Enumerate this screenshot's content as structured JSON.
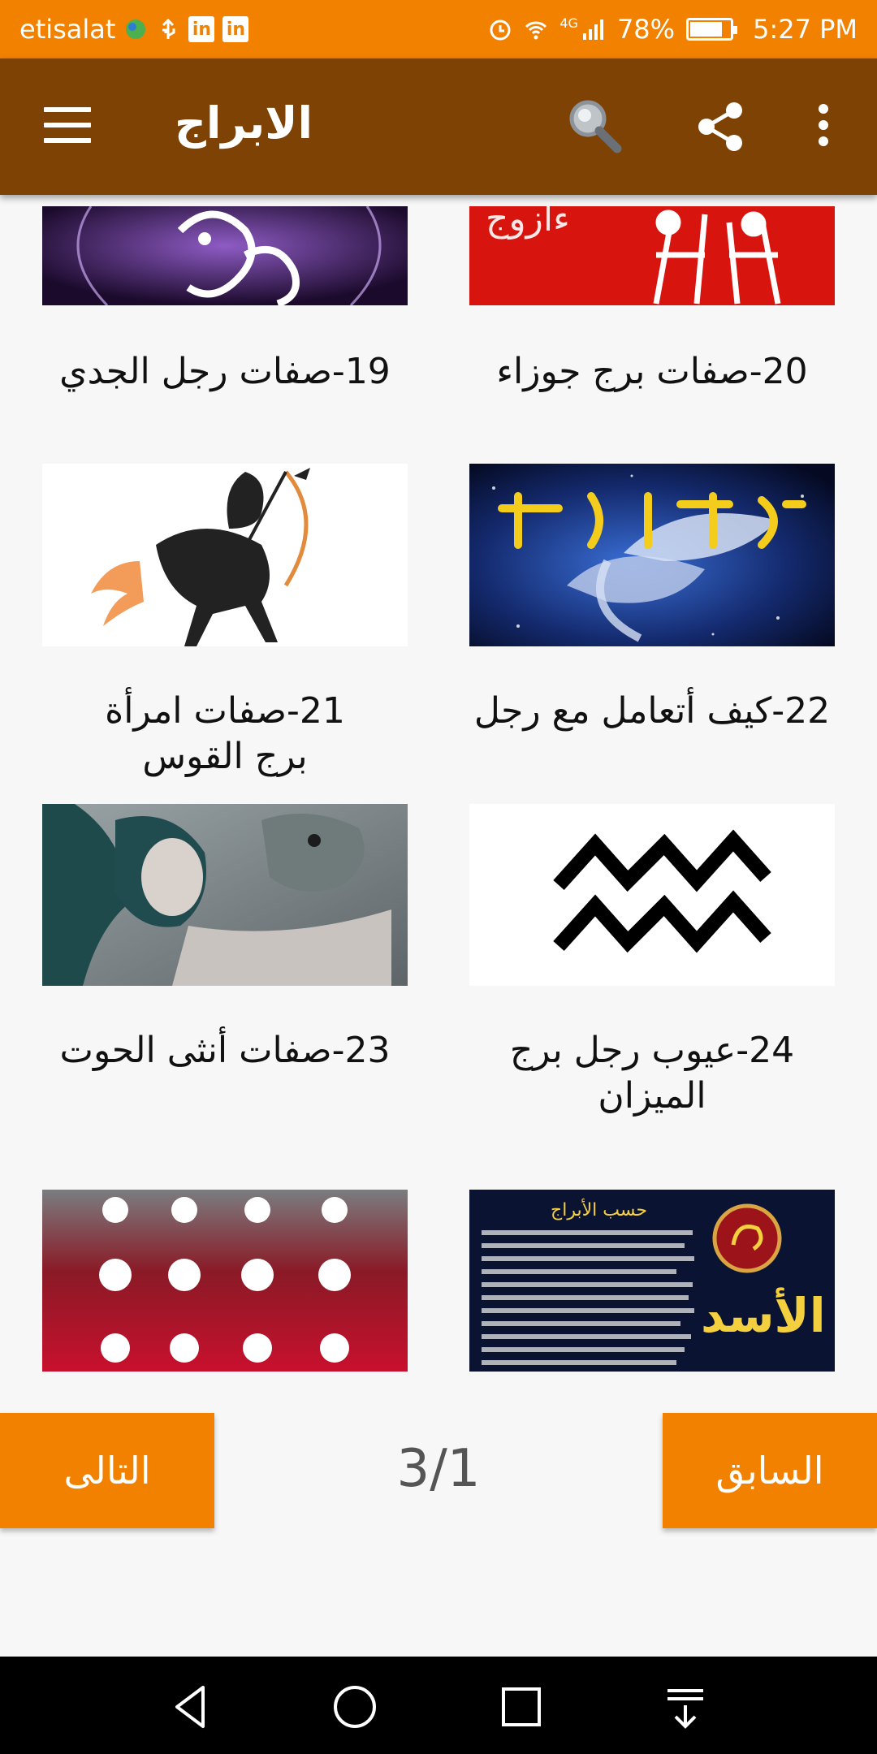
{
  "status_bar": {
    "carrier": "etisalat",
    "network": "4G",
    "battery": "78%",
    "time": "5:27 PM",
    "linkedin_icon_text": "in",
    "icons": [
      "globe-icon",
      "usb-icon",
      "linkedin-icon",
      "linkedin-icon",
      "alarm-icon",
      "wifi-icon",
      "signal-icon",
      "battery-icon"
    ]
  },
  "app_bar": {
    "title": "الابراج",
    "icons": [
      "menu-icon",
      "search-icon",
      "share-icon",
      "more-vert-icon"
    ],
    "color": "#7d4204"
  },
  "items": [
    {
      "caption": "20-صفات برج جوزاء",
      "image": "gemini-red"
    },
    {
      "caption": "19-صفات رجل الجدي",
      "image": "capricorn-purple"
    },
    {
      "caption": "22-كيف أتعامل مع رجل",
      "image": "pisces-fish-title"
    },
    {
      "caption": "21-صفات امرأة برج القوس",
      "image": "sagittarius-centaur"
    },
    {
      "caption": "24-عيوب رجل برج الميزان",
      "image": "aquarius-symbol"
    },
    {
      "caption": "23-صفات أنثى الحوت",
      "image": "fantasy-woman"
    },
    {
      "caption": "",
      "image": "leo-text-card",
      "image_text": [
        "حسب الأبراج",
        "الأسد"
      ]
    },
    {
      "caption": "",
      "image": "zodiac-symbols-grid"
    }
  ],
  "pager": {
    "prev_label": "السابق",
    "next_label": "التالى",
    "indicator": "3/1"
  },
  "colors": {
    "accent": "#f28100",
    "brown": "#7d4204",
    "background": "#f7f7f7"
  },
  "nav_bar": {
    "icons": [
      "back-icon",
      "home-icon",
      "recents-icon",
      "notifications-pull-icon"
    ]
  }
}
